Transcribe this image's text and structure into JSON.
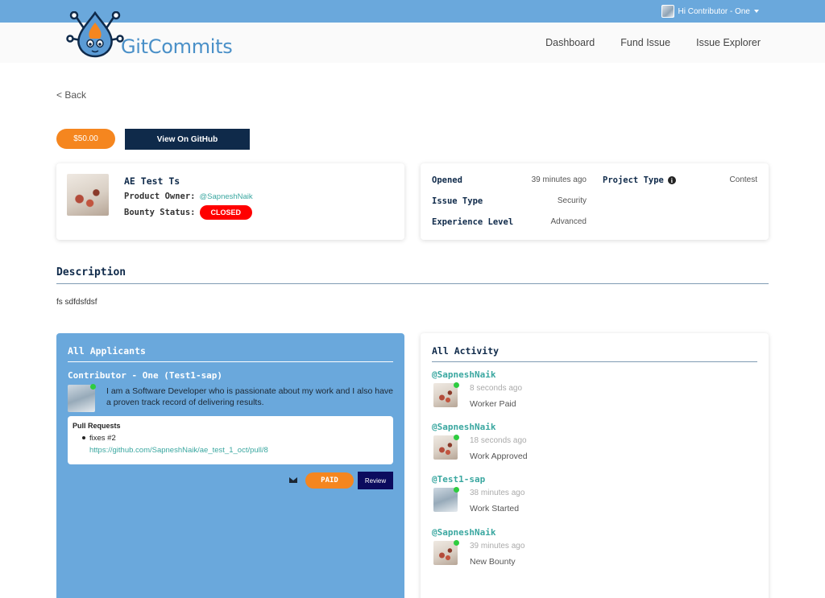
{
  "header": {
    "user_greeting": "Hi Contributor - One",
    "logo_text": "GitCommits",
    "nav": [
      "Dashboard",
      "Fund Issue",
      "Issue Explorer"
    ]
  },
  "back_label": "< Back",
  "bounty": {
    "amount": "$50.00",
    "github_label": "View On GitHub"
  },
  "issue": {
    "title": "AE Test Ts",
    "owner_label": "Product Owner:",
    "owner": "@SapneshNaik",
    "status_label": "Bounty Status:",
    "status": "CLOSED"
  },
  "meta": {
    "opened_label": "Opened",
    "opened": "39 minutes ago",
    "issue_type_label": "Issue Type",
    "issue_type": "Security",
    "experience_label": "Experience Level",
    "experience": "Advanced",
    "project_type_label": "Project Type",
    "project_type": "Contest"
  },
  "description": {
    "heading": "Description",
    "text": "fs sdfdsfdsf"
  },
  "applicants": {
    "heading": "All Applicants",
    "name": "Contributor - One (Test1-sap)",
    "bio": "I am a Software Developer who is passionate about my work and I also have a proven track record of delivering results.",
    "pr_title": "Pull Requests",
    "pr_item": "fixes #2",
    "pr_link": "https://github.com/SapneshNaik/ae_test_1_oct/pull/8",
    "paid_label": "PAID",
    "review_label": "Review"
  },
  "activity": {
    "heading": "All Activity",
    "items": [
      {
        "user": "@SapneshNaik",
        "time": "8 seconds ago",
        "text": "Worker Paid"
      },
      {
        "user": "@SapneshNaik",
        "time": "18 seconds ago",
        "text": "Work Approved"
      },
      {
        "user": "@Test1-sap",
        "time": "38 minutes ago",
        "text": "Work Started"
      },
      {
        "user": "@SapneshNaik",
        "time": "39 minutes ago",
        "text": "New Bounty"
      }
    ]
  },
  "colors": {
    "topbar": "#6aa8dc",
    "accent": "#f5861f",
    "navy": "#0f2a4a",
    "link": "#3aa7a0",
    "closed": "#ff0000"
  }
}
